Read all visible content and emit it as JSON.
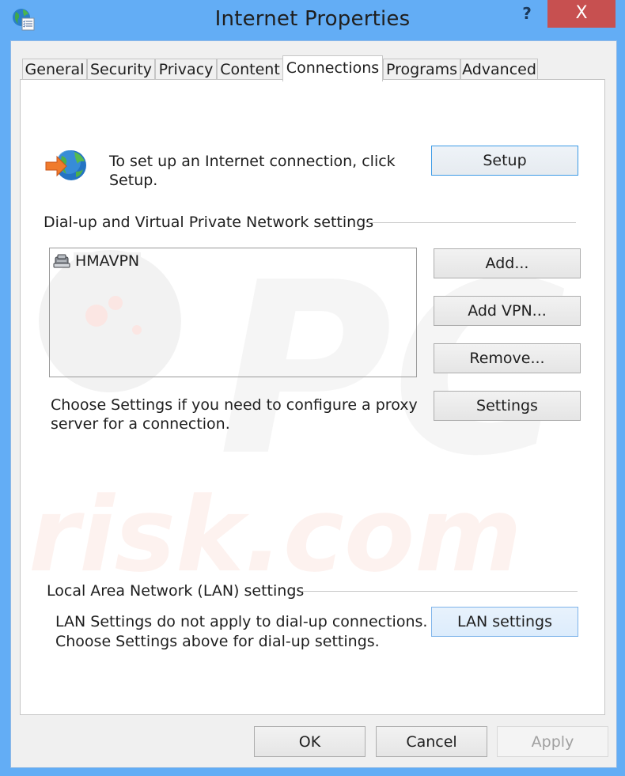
{
  "window": {
    "title": "Internet Properties",
    "help_label": "?",
    "close_label": "X",
    "app_icon": "internet-options-globe-icon"
  },
  "tabs": [
    {
      "label": "General",
      "active": false
    },
    {
      "label": "Security",
      "active": false
    },
    {
      "label": "Privacy",
      "active": false
    },
    {
      "label": "Content",
      "active": false
    },
    {
      "label": "Connections",
      "active": true
    },
    {
      "label": "Programs",
      "active": false
    },
    {
      "label": "Advanced",
      "active": false
    }
  ],
  "setup": {
    "icon": "globe-arrow-icon",
    "text_line1": "To set up an Internet connection, click",
    "text_line2": "Setup.",
    "button_label": "Setup"
  },
  "dialup": {
    "group_label": "Dial-up and Virtual Private Network settings",
    "connections": [
      {
        "name": "HMAVPN",
        "icon": "vpn-connection-icon"
      }
    ],
    "buttons": {
      "add": "Add...",
      "add_vpn": "Add VPN...",
      "remove": "Remove...",
      "settings": "Settings"
    },
    "proxy_text_line1": "Choose Settings if you need to configure a proxy",
    "proxy_text_line2": "server for a connection."
  },
  "lan": {
    "group_label": "Local Area Network (LAN) settings",
    "text_line1": "LAN Settings do not apply to dial-up connections.",
    "text_line2": "Choose Settings above for dial-up settings.",
    "button_label": "LAN settings"
  },
  "footer": {
    "ok": "OK",
    "cancel": "Cancel",
    "apply": "Apply",
    "apply_enabled": false
  },
  "watermark": {
    "text_top": "PC",
    "text_bottom": "risk.com"
  },
  "colors": {
    "window_frame": "#63adf5",
    "close_button": "#c75050",
    "default_button_border": "#3c9be6"
  }
}
